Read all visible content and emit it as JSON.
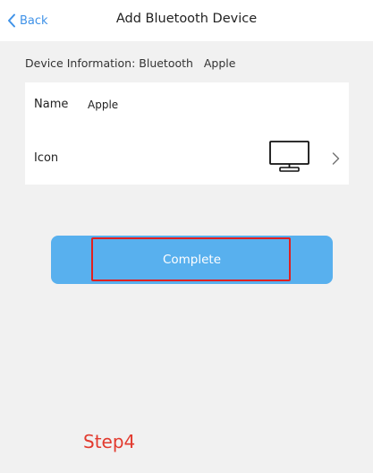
{
  "nav": {
    "back_label": "Back",
    "title": "Add Bluetooth Device"
  },
  "device_info": {
    "text": "Device Information: Bluetooth   Apple"
  },
  "form": {
    "name_label": "Name",
    "name_value": "Apple",
    "icon_label": "Icon",
    "icon_value": "monitor-icon"
  },
  "actions": {
    "complete_label": "Complete"
  },
  "annotation": {
    "step_label": "Step4"
  },
  "colors": {
    "accent": "#3f92e8",
    "button": "#58b0ee",
    "background": "#f1f1f1",
    "highlight": "#e02020"
  }
}
